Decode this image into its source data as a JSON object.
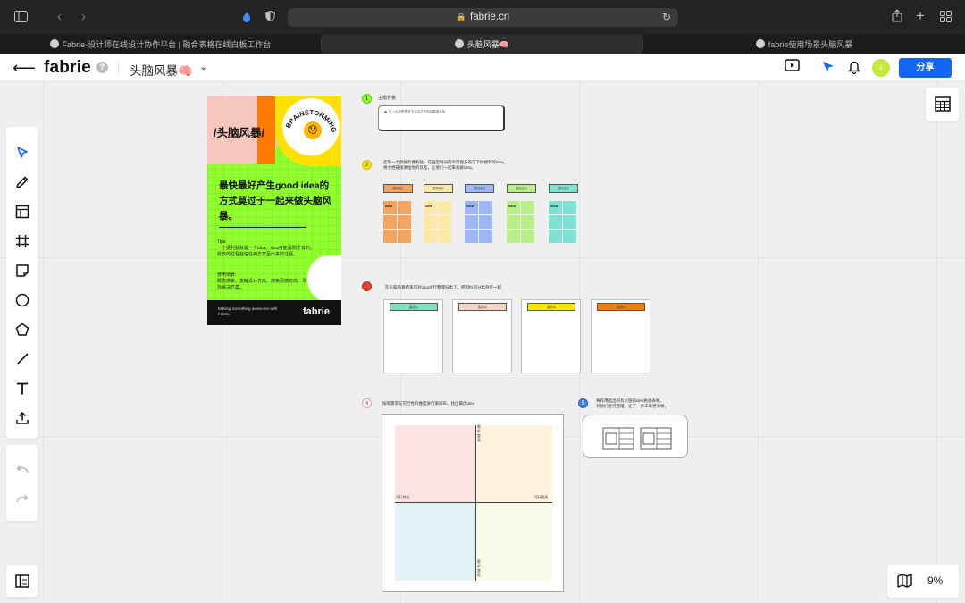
{
  "browser": {
    "url": "fabrie.cn",
    "tabs": [
      {
        "label": "Fabrie-设计师在线设计协作平台 | 融合表格在线白板工作台",
        "active": false
      },
      {
        "label": "头脑风暴🧠",
        "active": true
      },
      {
        "label": "fabrie使用场景头脑风暴",
        "active": false
      }
    ]
  },
  "header": {
    "logo": "fabrie",
    "help": "?",
    "doc_title": "头脑风暴🧠",
    "avatar": "I",
    "share_label": "分享"
  },
  "zoom": "9%",
  "poster": {
    "title": "/头脑风暴/",
    "badge": "BRAINSTORMING",
    "headline": "最快最好产生good idea的方式莫过于一起来做头脑风暴。",
    "tips": "Tips:\n一个便利贴就是一个idea。idea可能是刚才有的，收放的过程自信任何方案至出来的过程。",
    "use": "使用场景:\n概念搜索、发散设计方向、搜索灵感方向、寻找解决方案。",
    "footer_text": "Making something awesome with Fabrie.",
    "footer_logo": "fabrie"
  },
  "sections": {
    "s1": {
      "num": "1",
      "title": "主题背板",
      "input": "在一大空框里写下本次讨论的问题或目标"
    },
    "s2": {
      "num": "2",
      "text": "选取一个颜色的便利贴，在固定时间内尽可能多的写下你想到的idea。\n将文档链接发给你的队友，让他们一起来贡献idea。",
      "groups": [
        {
          "label": "便利贴1",
          "color": "#f5a35f",
          "idea": "idea"
        },
        {
          "label": "便利贴2",
          "color": "#fde9a6",
          "idea": "idea"
        },
        {
          "label": "便利贴3",
          "color": "#9db6f5",
          "idea": "idea"
        },
        {
          "label": "便利贴4",
          "color": "#b8ef8a",
          "idea": "idea"
        },
        {
          "label": "便利贴5",
          "color": "#7fe0d4",
          "idea": "idea"
        }
      ]
    },
    "s3": {
      "text": "在头脑风暴结束后对idea进行整理归类了，把相似的分类放在一起",
      "columns": [
        {
          "label": "类别1",
          "color": "#7fe0c4"
        },
        {
          "label": "类别2",
          "color": "#f7d4c8"
        },
        {
          "label": "类别3",
          "color": "#ffe600"
        },
        {
          "label": "类别4",
          "color": "#ff7a00"
        }
      ]
    },
    "s4": {
      "num": "4",
      "text": "按照需求与可行性的维度进行来排布，找出最优idea",
      "axis_top": "需求度高",
      "axis_bottom": "需求度低",
      "axis_left": "可行性低",
      "axis_right": "可行性高"
    },
    "s5": {
      "num": "5",
      "text": "将有用选出的有价值的idea拖进表格。\n对他们进行整理，让下一步工作更清晰。"
    }
  },
  "colors": {
    "accent": "#1467f5",
    "poster_green": "#8fff2e"
  }
}
